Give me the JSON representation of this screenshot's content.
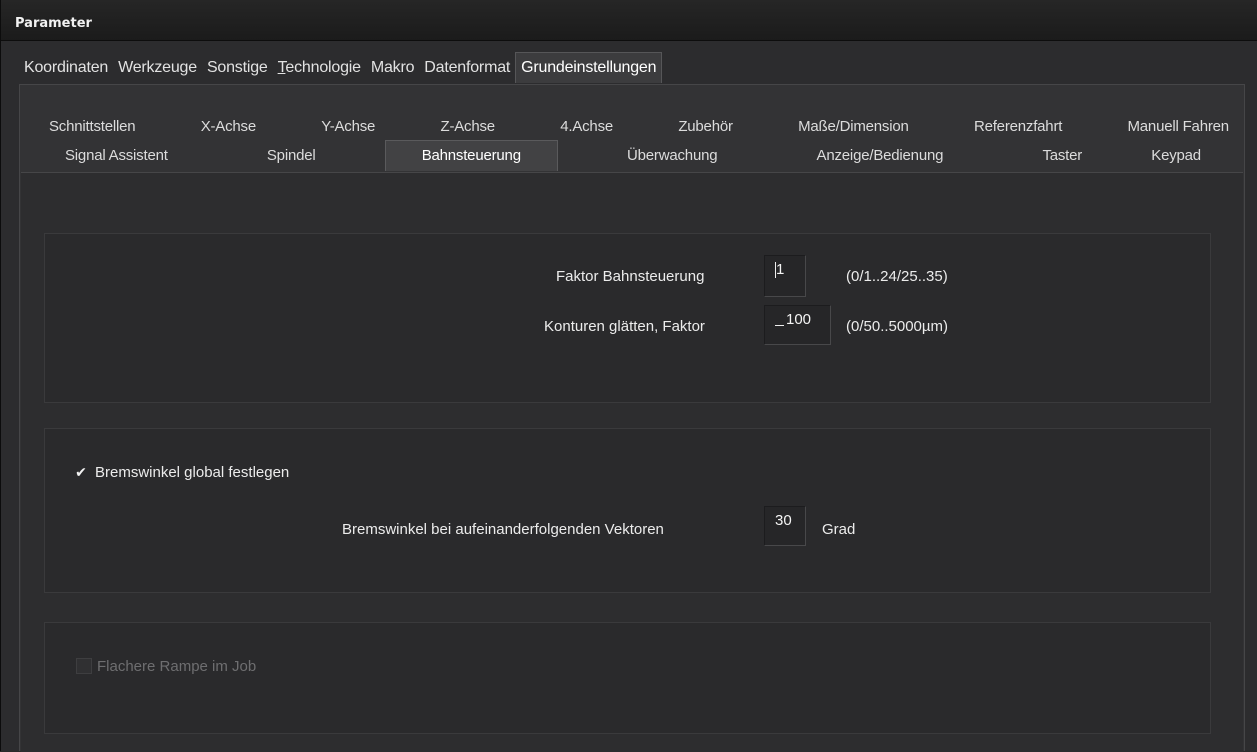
{
  "window": {
    "title": "Parameter"
  },
  "tabs_top": [
    {
      "label": "Koordinaten",
      "active": false
    },
    {
      "label": "Werkzeuge",
      "active": false
    },
    {
      "label": "Sonstige",
      "active": false
    },
    {
      "label_prefix": "",
      "label_ul": "T",
      "label_rest": "echnologie",
      "active": false
    },
    {
      "label": "Makro",
      "active": false
    },
    {
      "label": "Datenformat",
      "active": false
    },
    {
      "label": "Grundeinstellungen",
      "active": true
    }
  ],
  "subtabs_row1": [
    "Schnittstellen",
    "X-Achse",
    "Y-Achse",
    "Z-Achse",
    "4.Achse",
    "Zubehör",
    "Maße/Dimension",
    "Referenzfahrt",
    "Manuell Fahren"
  ],
  "subtabs_row2": [
    {
      "label": "Signal Assistent",
      "active": false
    },
    {
      "label": "Spindel",
      "active": false
    },
    {
      "label": "Bahnsteuerung",
      "active": true
    },
    {
      "label": "Überwachung",
      "active": false
    },
    {
      "label": "Anzeige/Bedienung",
      "active": false
    },
    {
      "label": "Taster",
      "active": false
    },
    {
      "label": "Keypad",
      "active": false
    }
  ],
  "group1": {
    "faktor_label": "Faktor Bahnsteuerung",
    "faktor_value": "1",
    "faktor_range": "(0/1..24/25..35)",
    "konturen_label": "Konturen glätten, Faktor",
    "konturen_value": "100",
    "konturen_range": "(0/50..5000µm)"
  },
  "group2": {
    "checkbox_label": "Bremswinkel global festlegen",
    "checkbox_checked": true,
    "angle_label": "Bremswinkel bei aufeinanderfolgenden Vektoren",
    "angle_value": "30",
    "angle_unit": "Grad"
  },
  "group3": {
    "checkbox_label": "Flachere Rampe im Job",
    "checkbox_checked": false,
    "checkbox_enabled": false
  }
}
